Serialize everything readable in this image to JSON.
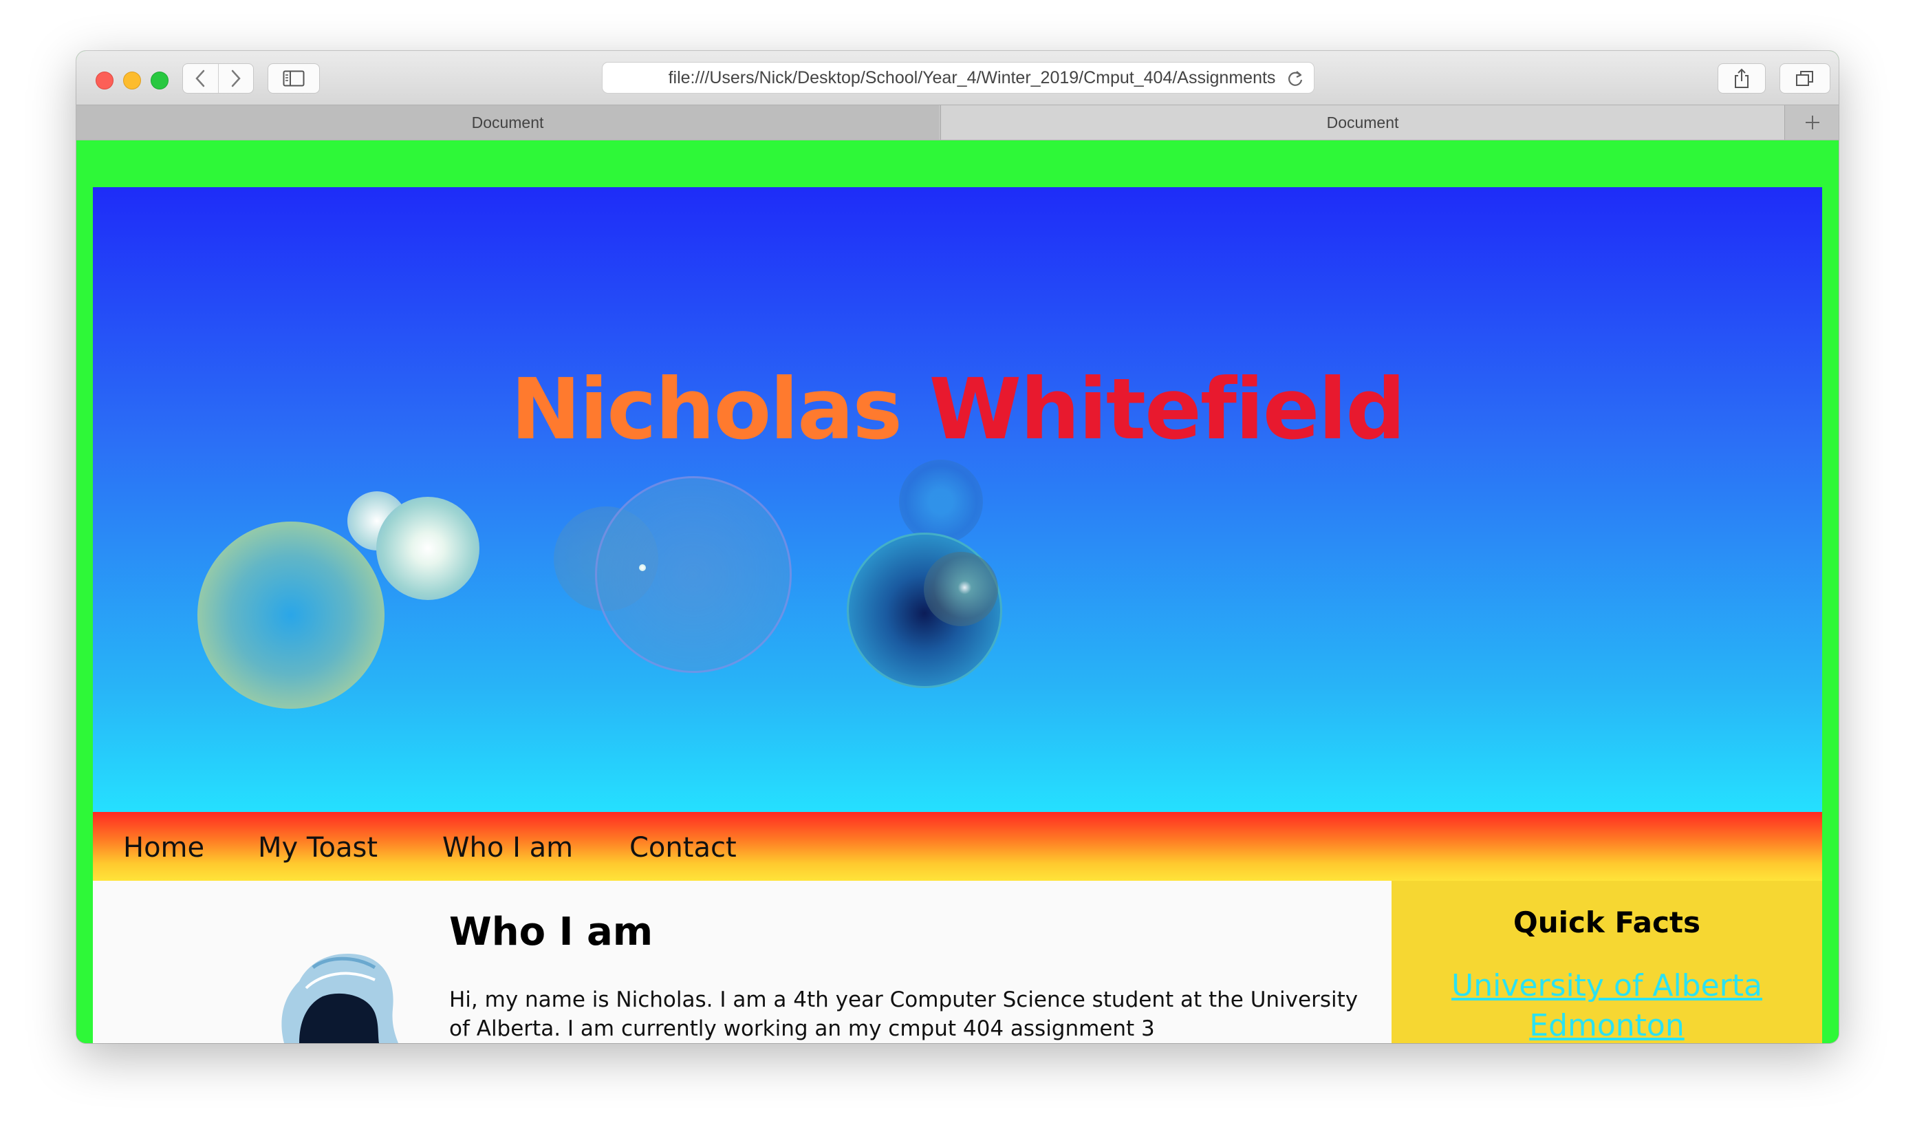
{
  "browser": {
    "url": "file:///Users/Nick/Desktop/School/Year_4/Winter_2019/Cmput_404/Assignments",
    "tabs": [
      {
        "label": "Document"
      },
      {
        "label": "Document"
      }
    ]
  },
  "hero": {
    "first_name": "Nicholas",
    "last_name": "Whitefield"
  },
  "nav": {
    "items": [
      {
        "label": "Home"
      },
      {
        "label": "My Toast"
      },
      {
        "label": "Who I am"
      },
      {
        "label": "Contact"
      }
    ]
  },
  "main": {
    "heading": "Who I am",
    "paragraph": "Hi, my name is Nicholas. I am a 4th year Computer Science student at the University of Alberta. I am currently working an my cmput 404 assignment 3"
  },
  "sidebar": {
    "heading": "Quick Facts",
    "link": "University of Alberta Edmonton"
  },
  "colors": {
    "page_bg": "#2ef838",
    "hero_top": "#1e2cf8",
    "hero_bottom": "#25e0ff",
    "title_first": "#ff7a2e",
    "title_last": "#e8192e",
    "nav_top": "#ff2a22",
    "nav_bottom": "#ffe43a",
    "sidebar_bg": "#f6d732",
    "link": "#2be2f2"
  },
  "icons": [
    "back-icon",
    "forward-icon",
    "sidebar-icon",
    "reload-icon",
    "share-icon",
    "tabs-overview-icon",
    "new-tab-icon",
    "avatar-image"
  ]
}
